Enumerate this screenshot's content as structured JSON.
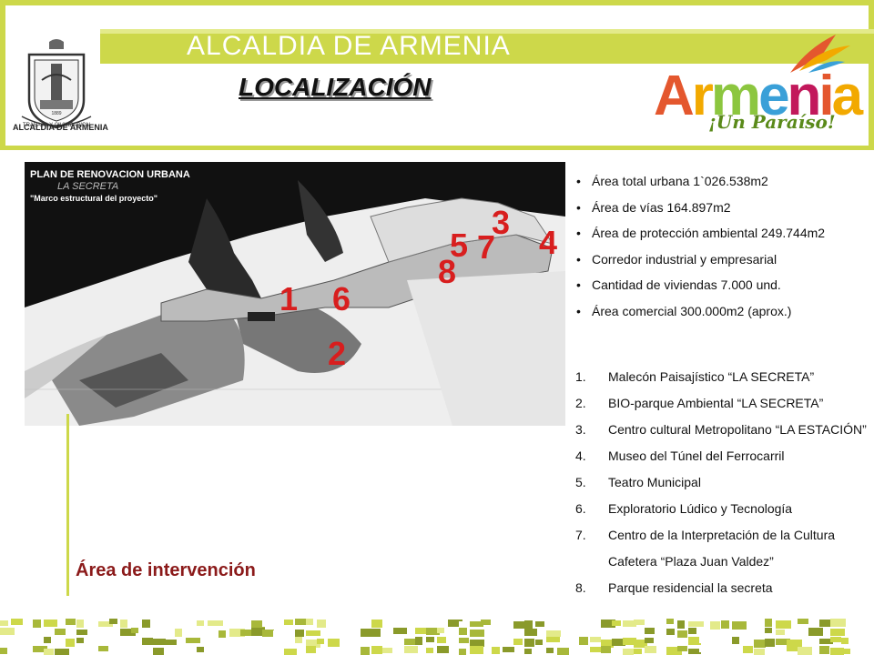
{
  "header": {
    "title": "ALCALDIA DE ARMENIA",
    "coat_caption": "ALCALDIA DE ARMENIA",
    "coat_motto": "TRABAJO Y CIVILIZACION",
    "coat_year": "1889"
  },
  "page_title": "LOCALIZACIÓN",
  "brand": {
    "word": "Armenia",
    "slogan": "¡Un Paraíso!",
    "colors": [
      "#e4572e",
      "#f2a900",
      "#8cc63f",
      "#3aa0d8",
      "#c2185b",
      "#e4572e",
      "#f2a900"
    ]
  },
  "map": {
    "title": "PLAN DE RENOVACION URBANA",
    "subtitle1": "LA SECRETA",
    "subtitle2": "\"Marco estructural del proyecto\"",
    "numbers": [
      "1",
      "2",
      "3",
      "4",
      "5",
      "6",
      "7",
      "8"
    ]
  },
  "bullets": [
    "Área total urbana 1`026.538m2",
    "Área de vías 164.897m2",
    "Área de protección ambiental 249.744m2",
    "Corredor industrial y empresarial",
    "Cantidad de viviendas 7.000 und.",
    "Área comercial 300.000m2 (aprox.)"
  ],
  "numbered": [
    {
      "n": "1.",
      "text": "Malecón Paisajístico “LA SECRETA”"
    },
    {
      "n": "2.",
      "text": "BIO-parque Ambiental “LA SECRETA”"
    },
    {
      "n": "3.",
      "text": "Centro cultural Metropolitano “LA ESTACIÓN”"
    },
    {
      "n": "4.",
      "text": "Museo del Túnel del Ferrocarril"
    },
    {
      "n": "5.",
      "text": "Teatro Municipal"
    },
    {
      "n": "6.",
      "text": "Exploratorio Lúdico y Tecnología"
    },
    {
      "n": "7.",
      "text": "Centro de la Interpretación de la Cultura Cafetera “Plaza Juan Valdez”"
    },
    {
      "n": "8.",
      "text": "Parque residencial la secreta"
    }
  ],
  "area_label": "Área de intervención",
  "colors": {
    "accent_green": "#cdd84a",
    "map_number_red": "#d81e1e",
    "area_label": "#8b1a1a"
  }
}
